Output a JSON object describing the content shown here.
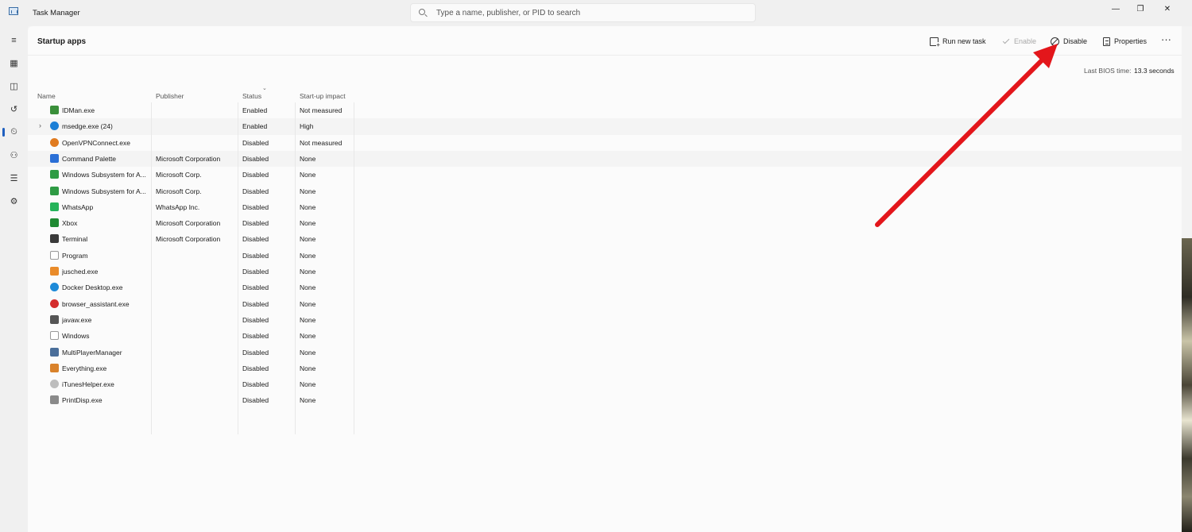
{
  "titlebar": {
    "title": "Task Manager",
    "search_placeholder": "Type a name, publisher, or PID to search",
    "minimize": "—",
    "maximize": "❐",
    "close": "✕"
  },
  "nav": {
    "items": [
      {
        "name": "hamburger-menu-icon",
        "glyph": "≡"
      },
      {
        "name": "processes-icon",
        "glyph": "▦"
      },
      {
        "name": "performance-icon",
        "glyph": "◫"
      },
      {
        "name": "app-history-icon",
        "glyph": "↺"
      },
      {
        "name": "startup-apps-icon",
        "glyph": "⏲"
      },
      {
        "name": "users-icon",
        "glyph": "⚇"
      },
      {
        "name": "details-icon",
        "glyph": "☰"
      },
      {
        "name": "services-icon",
        "glyph": "⚙"
      }
    ]
  },
  "page": {
    "title": "Startup apps",
    "bios_label": "Last BIOS time:",
    "bios_value": "13.3 seconds"
  },
  "toolbar": {
    "run_new_task": "Run new task",
    "enable": "Enable",
    "disable": "Disable",
    "properties": "Properties",
    "more": "···"
  },
  "table": {
    "columns": {
      "name": "Name",
      "publisher": "Publisher",
      "status": "Status",
      "impact": "Start-up impact"
    },
    "rows": [
      {
        "name": "IDMan.exe",
        "publisher": "",
        "status": "Enabled",
        "impact": "Not measured",
        "icon": "idm-icon",
        "color": "#3a8f3a"
      },
      {
        "name": "msedge.exe (24)",
        "publisher": "",
        "status": "Enabled",
        "impact": "High",
        "icon": "edge-icon",
        "color": "#1c7fd6",
        "expandable": true
      },
      {
        "name": "OpenVPNConnect.exe",
        "publisher": "",
        "status": "Disabled",
        "impact": "Not measured",
        "icon": "openvpn-icon",
        "color": "#e07b20"
      },
      {
        "name": "Command Palette",
        "publisher": "Microsoft Corporation",
        "status": "Disabled",
        "impact": "None",
        "icon": "command-palette-icon",
        "color": "#2a6fd6"
      },
      {
        "name": "Windows Subsystem for A...",
        "publisher": "Microsoft Corp.",
        "status": "Disabled",
        "impact": "None",
        "icon": "wsa-icon",
        "color": "#2e9b44"
      },
      {
        "name": "Windows Subsystem for A...",
        "publisher": "Microsoft Corp.",
        "status": "Disabled",
        "impact": "None",
        "icon": "wsa-icon",
        "color": "#2e9b44"
      },
      {
        "name": "WhatsApp",
        "publisher": "WhatsApp Inc.",
        "status": "Disabled",
        "impact": "None",
        "icon": "whatsapp-icon",
        "color": "#25b45a"
      },
      {
        "name": "Xbox",
        "publisher": "Microsoft Corporation",
        "status": "Disabled",
        "impact": "None",
        "icon": "xbox-icon",
        "color": "#1f8a32"
      },
      {
        "name": "Terminal",
        "publisher": "Microsoft Corporation",
        "status": "Disabled",
        "impact": "None",
        "icon": "terminal-icon",
        "color": "#3a3a3a"
      },
      {
        "name": "Program",
        "publisher": "",
        "status": "Disabled",
        "impact": "None",
        "icon": "blank-file-icon",
        "color": "#ffffff"
      },
      {
        "name": "jusched.exe",
        "publisher": "",
        "status": "Disabled",
        "impact": "None",
        "icon": "java-icon",
        "color": "#e98b2a"
      },
      {
        "name": "Docker Desktop.exe",
        "publisher": "",
        "status": "Disabled",
        "impact": "None",
        "icon": "docker-icon",
        "color": "#1d8ad8"
      },
      {
        "name": "browser_assistant.exe",
        "publisher": "",
        "status": "Disabled",
        "impact": "None",
        "icon": "opera-icon",
        "color": "#d42c2c"
      },
      {
        "name": "javaw.exe",
        "publisher": "",
        "status": "Disabled",
        "impact": "None",
        "icon": "javaw-icon",
        "color": "#555555"
      },
      {
        "name": "Windows",
        "publisher": "",
        "status": "Disabled",
        "impact": "None",
        "icon": "blank-file-icon",
        "color": "#ffffff"
      },
      {
        "name": "MultiPlayerManager",
        "publisher": "",
        "status": "Disabled",
        "impact": "None",
        "icon": "window-icon",
        "color": "#4a6e9a"
      },
      {
        "name": "Everything.exe",
        "publisher": "",
        "status": "Disabled",
        "impact": "None",
        "icon": "everything-icon",
        "color": "#d9822b"
      },
      {
        "name": "iTunesHelper.exe",
        "publisher": "",
        "status": "Disabled",
        "impact": "None",
        "icon": "itunes-icon",
        "color": "#bdbdbd"
      },
      {
        "name": "PrintDisp.exe",
        "publisher": "",
        "status": "Disabled",
        "impact": "None",
        "icon": "printer-icon",
        "color": "#8a8a8a"
      }
    ]
  },
  "colors": {
    "annotation_arrow": "#e3161b",
    "accent": "#1f5fbf"
  }
}
